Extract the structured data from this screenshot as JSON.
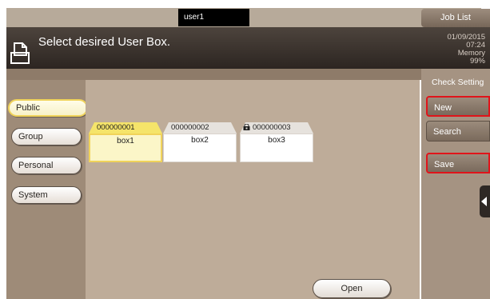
{
  "topbar": {
    "user": "user1",
    "job_list": "Job List"
  },
  "header": {
    "title": "Select desired User Box.",
    "date": "01/09/2015",
    "time": "07:24",
    "memory_label": "Memory",
    "memory_value": "99%"
  },
  "tabs": [
    {
      "label": "Public",
      "active": true
    },
    {
      "label": "Group",
      "active": false
    },
    {
      "label": "Personal",
      "active": false
    },
    {
      "label": "System",
      "active": false
    }
  ],
  "boxes": [
    {
      "number": "000000001",
      "name": "box1",
      "selected": true,
      "locked": false
    },
    {
      "number": "000000002",
      "name": "box2",
      "selected": false,
      "locked": false
    },
    {
      "number": "000000003",
      "name": "box3",
      "selected": false,
      "locked": true
    }
  ],
  "sidebar": {
    "check_setting": "Check Setting",
    "new": "New",
    "search": "Search",
    "save": "Save"
  },
  "actions": {
    "open": "Open"
  },
  "colors": {
    "highlight": "#e0141a",
    "selected_box": "#fbf6c8",
    "active_tab_border": "#f0d35a"
  }
}
